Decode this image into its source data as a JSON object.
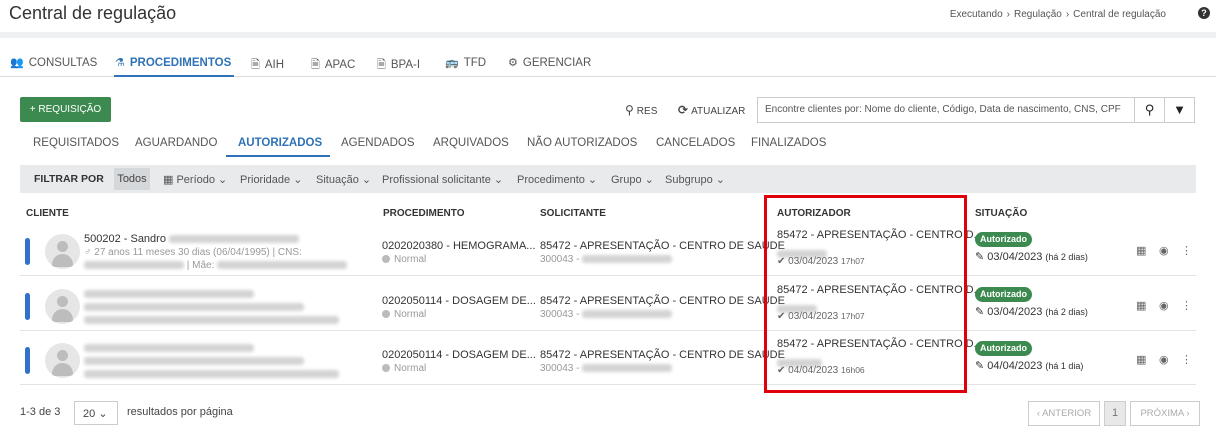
{
  "header": {
    "title": "Central de regulação",
    "breadcrumb": [
      "Executando",
      "Regulação",
      "Central de regulação"
    ],
    "help_icon": "?"
  },
  "module_tabs": [
    {
      "icon": "users-icon",
      "glyph": "👥",
      "label": "CONSULTAS"
    },
    {
      "icon": "flask-icon",
      "glyph": "⚗",
      "label": "PROCEDIMENTOS",
      "active": true
    },
    {
      "icon": "doc-icon",
      "glyph": "🗎",
      "label": "AIH"
    },
    {
      "icon": "doc-icon",
      "glyph": "🗎",
      "label": "APAC"
    },
    {
      "icon": "doc-icon",
      "glyph": "🗎",
      "label": "BPA-I"
    },
    {
      "icon": "bus-icon",
      "glyph": "🚌",
      "label": "TFD"
    },
    {
      "icon": "gear-icon",
      "glyph": "⚙",
      "label": "GERENCIAR"
    }
  ],
  "toolbar": {
    "new_label": "+ REQUISIÇÃO",
    "res_label": "RES",
    "refresh_label": "ATUALIZAR",
    "search_placeholder": "Encontre clientes por: Nome do cliente, Código, Data de nascimento, CNS, CPF"
  },
  "status_tabs": [
    "REQUISITADOS",
    "AGUARDANDO",
    "AUTORIZADOS",
    "AGENDADOS",
    "ARQUIVADOS",
    "NÃO AUTORIZADOS",
    "CANCELADOS",
    "FINALIZADOS"
  ],
  "filters": {
    "label": "FILTRAR POR",
    "all": "Todos",
    "items": [
      "Período",
      "Prioridade",
      "Situação",
      "Profissional solicitante",
      "Procedimento",
      "Grupo",
      "Subgrupo"
    ]
  },
  "columns": [
    "CLIENTE",
    "PROCEDIMENTO",
    "SOLICITANTE",
    "AUTORIZADOR",
    "SITUAÇÃO"
  ],
  "rows": [
    {
      "client_name": "500202 - Sandro",
      "client_info": "♂ 27 anos 11 meses 30 dias (06/04/1995) | CNS:",
      "client_info2": "| Mãe:",
      "procedure": "0202020380 - HEMOGRAMA...",
      "priority": "Normal",
      "requester": "85472 - APRESENTAÇÃO - CENTRO DE SAÚDE",
      "requester_code": "300043 -",
      "authorizer": "85472 - APRESENTAÇÃO - CENTRO D...",
      "auth_date": "03/04/2023",
      "auth_time": "17h07",
      "status": "Autorizado",
      "status_date": "03/04/2023",
      "status_rel": "(há 2 dias)"
    },
    {
      "client_name": "",
      "client_info": "",
      "client_info2": "",
      "procedure": "0202050114 - DOSAGEM DE...",
      "priority": "Normal",
      "requester": "85472 - APRESENTAÇÃO - CENTRO DE SAÚDE",
      "requester_code": "300043 -",
      "authorizer": "85472 - APRESENTAÇÃO - CENTRO D...",
      "auth_date": "03/04/2023",
      "auth_time": "17h07",
      "status": "Autorizado",
      "status_date": "03/04/2023",
      "status_rel": "(há 2 dias)"
    },
    {
      "client_name": "",
      "client_info": "",
      "client_info2": "",
      "procedure": "0202050114 - DOSAGEM DE...",
      "priority": "Normal",
      "requester": "85472 - APRESENTAÇÃO - CENTRO DE SAÚDE",
      "requester_code": "300043 -",
      "authorizer": "85472 - APRESENTAÇÃO - CENTRO D...",
      "auth_date": "04/04/2023",
      "auth_time": "16h06",
      "status": "Autorizado",
      "status_date": "04/04/2023",
      "status_rel": "(há 1 dia)"
    }
  ],
  "footer": {
    "count": "1-3 de 3",
    "page_size": "20",
    "per_page_label": "resultados por página",
    "prev_label": "‹ ANTERIOR",
    "page": "1",
    "next_label": "PRÓXIMA ›"
  },
  "colors": {
    "accent": "#2f72b5",
    "success": "#3c8a4f",
    "highlight": "#e0000b"
  }
}
